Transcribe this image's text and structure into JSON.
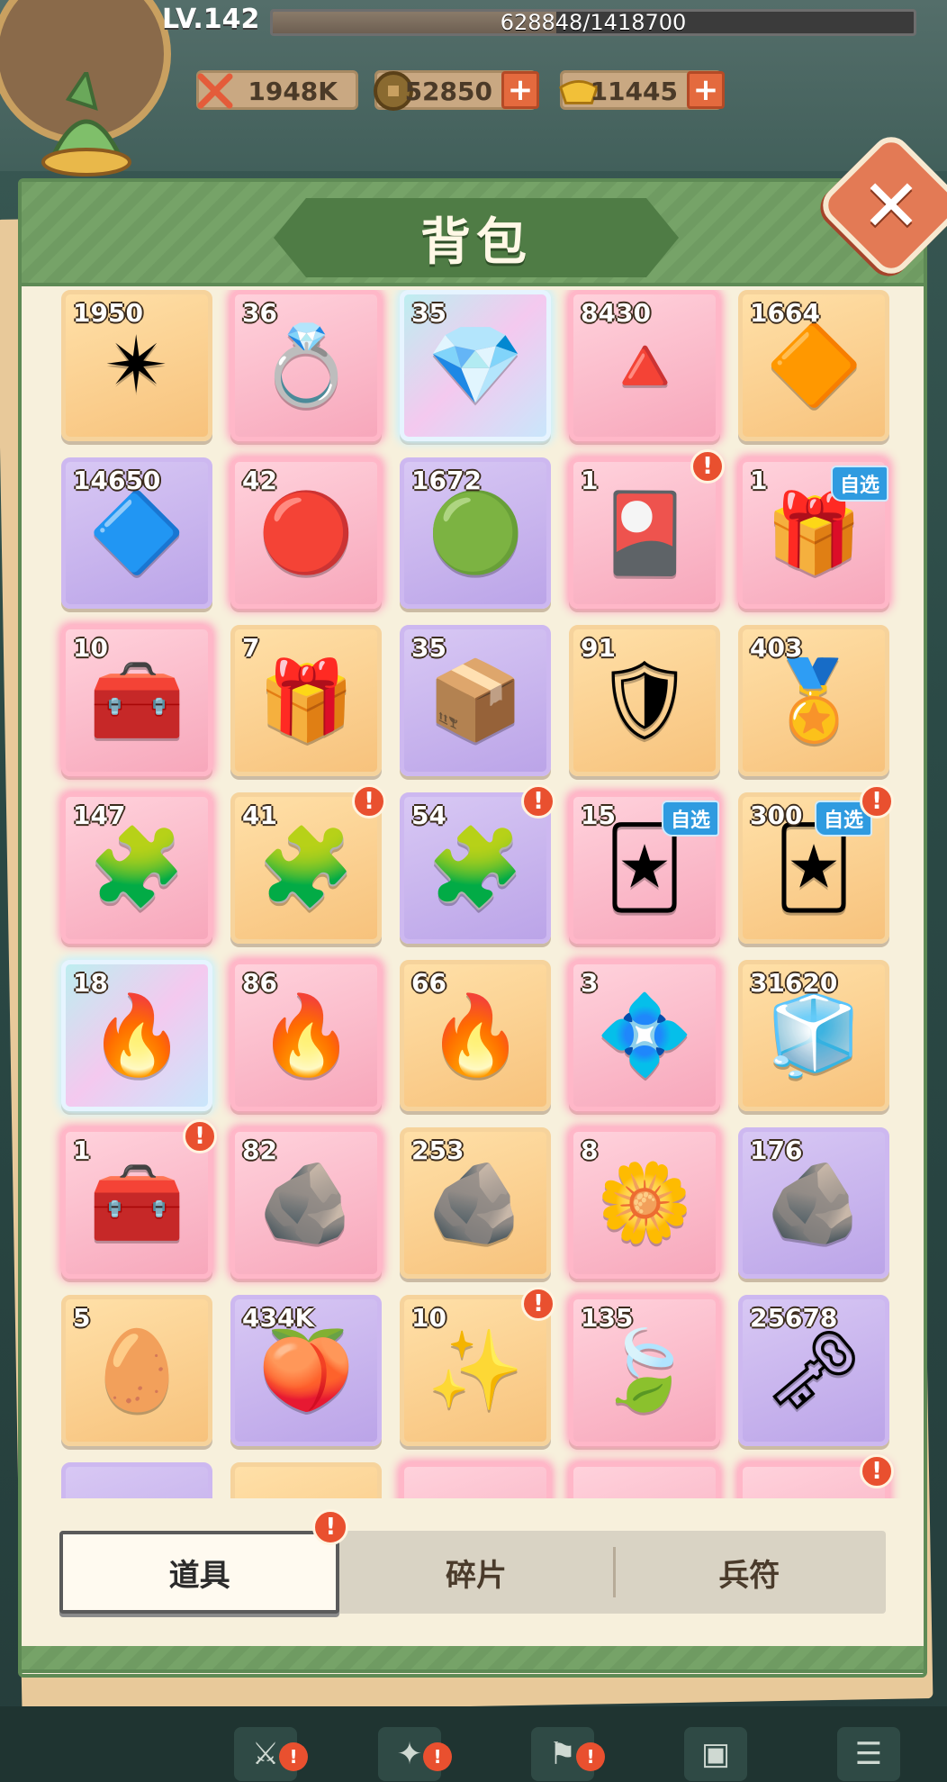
{
  "hud": {
    "level_label": "LV.142",
    "exp_text": "628848/1418700",
    "exp_fraction": 0.443,
    "power": {
      "icon": "crossed-swords-icon",
      "value": "1948K"
    },
    "coins": {
      "icon": "coin-icon",
      "value": "52850"
    },
    "ingots": {
      "icon": "gold-ingot-icon",
      "value": "11445"
    },
    "plus_label": "+"
  },
  "panel": {
    "title": "背包",
    "close_label": "✕"
  },
  "items": [
    {
      "count": "1950",
      "color": "orange",
      "icon": "red-star-gem",
      "glyph": "✴"
    },
    {
      "count": "36",
      "color": "pink",
      "icon": "pink-gem-ring",
      "glyph": "💍"
    },
    {
      "count": "35",
      "color": "rainbow",
      "icon": "rainbow-gem-ring",
      "glyph": "💎"
    },
    {
      "count": "8430",
      "color": "pink",
      "icon": "red-crystal",
      "glyph": "🔺"
    },
    {
      "count": "1664",
      "color": "orange",
      "icon": "gold-crystal",
      "glyph": "🔶"
    },
    {
      "count": "14650",
      "color": "purple",
      "icon": "purple-crystal-shard",
      "glyph": "🔷"
    },
    {
      "count": "42",
      "color": "pink",
      "icon": "red-octagon-gem",
      "glyph": "🔴"
    },
    {
      "count": "1672",
      "color": "purple",
      "icon": "orb-tray",
      "glyph": "🟢"
    },
    {
      "count": "1",
      "color": "pink",
      "icon": "mystery-card-box",
      "glyph": "🎴",
      "alert": true
    },
    {
      "count": "1",
      "color": "pink",
      "icon": "hero-card-box",
      "glyph": "🎁",
      "select": "自选"
    },
    {
      "count": "10",
      "color": "pink",
      "icon": "general-chest",
      "glyph": "🧰"
    },
    {
      "count": "7",
      "color": "orange",
      "icon": "gift-box",
      "glyph": "🎁"
    },
    {
      "count": "35",
      "color": "purple",
      "icon": "mystery-chest",
      "glyph": "📦"
    },
    {
      "count": "91",
      "color": "orange",
      "icon": "purple-general-token",
      "glyph": "🛡"
    },
    {
      "count": "403",
      "color": "orange",
      "icon": "gold-general-token",
      "glyph": "🏅"
    },
    {
      "count": "147",
      "color": "pink",
      "icon": "pink-puzzle-piece",
      "glyph": "🧩"
    },
    {
      "count": "41",
      "color": "orange",
      "icon": "orange-puzzle-piece",
      "glyph": "🧩",
      "alert": true
    },
    {
      "count": "54",
      "color": "purple",
      "icon": "purple-puzzle-piece",
      "glyph": "🧩",
      "alert": true
    },
    {
      "count": "15",
      "color": "pink",
      "icon": "hero-card-pack",
      "glyph": "🃏",
      "select": "自选"
    },
    {
      "count": "300",
      "color": "orange",
      "icon": "armored-hero-card",
      "glyph": "🃏",
      "select": "自选",
      "alert": true
    },
    {
      "count": "18",
      "color": "rainbow",
      "icon": "blue-flame",
      "glyph": "🔥"
    },
    {
      "count": "86",
      "color": "pink",
      "icon": "red-flame",
      "glyph": "🔥"
    },
    {
      "count": "66",
      "color": "orange",
      "icon": "gold-flame",
      "glyph": "🔥"
    },
    {
      "count": "3",
      "color": "pink",
      "icon": "violet-crystal-cluster",
      "glyph": "💠"
    },
    {
      "count": "31620",
      "color": "orange",
      "icon": "blue-crystal-cluster",
      "glyph": "🧊"
    },
    {
      "count": "1",
      "color": "pink",
      "icon": "treasure-chest-gem",
      "glyph": "🧰",
      "alert": true
    },
    {
      "count": "82",
      "color": "pink",
      "icon": "pink-rough-stone",
      "glyph": "🪨"
    },
    {
      "count": "253",
      "color": "orange",
      "icon": "brown-rough-stone",
      "glyph": "🪨"
    },
    {
      "count": "8",
      "color": "pink",
      "icon": "gold-flower-emblem",
      "glyph": "🌼"
    },
    {
      "count": "176",
      "color": "purple",
      "icon": "dark-rough-stone",
      "glyph": "🪨"
    },
    {
      "count": "5",
      "color": "orange",
      "icon": "fire-egg",
      "glyph": "🥚"
    },
    {
      "count": "434K",
      "color": "purple",
      "icon": "peach-leaves",
      "glyph": "🍑"
    },
    {
      "count": "10",
      "color": "orange",
      "icon": "gold-dust-cushion",
      "glyph": "✨",
      "alert": true
    },
    {
      "count": "135",
      "color": "pink",
      "icon": "jade-leaf-gem",
      "glyph": "🍃"
    },
    {
      "count": "25678",
      "color": "purple",
      "icon": "star-key",
      "glyph": "🗝"
    },
    {
      "count": "",
      "color": "purple",
      "icon": "partial-item",
      "glyph": ""
    },
    {
      "count": "",
      "color": "orange",
      "icon": "partial-item",
      "glyph": ""
    },
    {
      "count": "",
      "color": "pink",
      "icon": "partial-item",
      "glyph": ""
    },
    {
      "count": "",
      "color": "pink",
      "icon": "partial-item",
      "glyph": ""
    },
    {
      "count": "",
      "color": "pink",
      "icon": "partial-item",
      "glyph": "",
      "alert": true
    }
  ],
  "alert_label": "!",
  "tabs": [
    {
      "label": "道具",
      "active": true,
      "alert": true
    },
    {
      "label": "碎片",
      "active": false
    },
    {
      "label": "兵符",
      "active": false
    }
  ]
}
